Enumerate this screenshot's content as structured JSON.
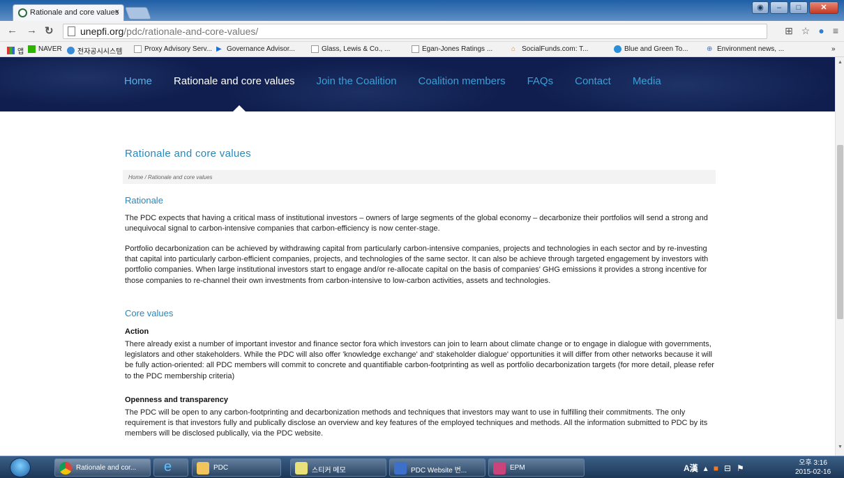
{
  "browser": {
    "tab_title": "Rationale and core values",
    "tab_close": "×",
    "url_host": "unepfi.org",
    "url_path": "/pdc/rationale-and-core-values/",
    "bookmarks": [
      "앱",
      "NAVER",
      "전자공시시스템",
      "Proxy Advisory Serv...",
      "Governance Advisor...",
      "Glass, Lewis & Co., ...",
      "Egan-Jones Ratings ...",
      "SocialFunds.com: T...",
      "Blue and Green To...",
      "Environment news, ..."
    ],
    "bookmarks_more": "»"
  },
  "nav": [
    "Home",
    "Rationale and core values",
    "Join the Coalition",
    "Coalition members",
    "FAQs",
    "Contact",
    "Media"
  ],
  "page": {
    "title": "Rationale and core values",
    "breadcrumb": "Home  /  Rationale and core values",
    "rationale_heading": "Rationale",
    "rationale_p1": "The PDC expects that having a critical mass of institutional investors – owners of large segments of the global economy – decarbonize their portfolios will send a strong and unequivocal signal to carbon-intensive companies that carbon-efficiency is now center-stage.",
    "rationale_p2": "Portfolio decarbonization can be achieved by withdrawing capital from particularly carbon-intensive companies, projects and technologies in each sector and by re-investing that capital into particularly carbon-efficient companies, projects, and technologies of the same sector. It can also be achieve through targeted engagement by investors with portfolio companies. When large institutional investors start to engage and/or re-allocate capital on the basis of companies' GHG emissions it provides a strong incentive for those companies to re-channel their own investments from carbon-intensive to low-carbon activities, assets and technologies.",
    "core_heading": "Core values",
    "action_heading": "Action",
    "action_p": "There already exist a number of important investor and finance sector fora which investors can join to learn about climate change or to engage in dialogue with governments, legislators and other stakeholders. While the PDC will also offer 'knowledge exchange' and' stakeholder dialogue' opportunities it will differ from other networks because it will be fully action-oriented: all PDC members will commit to concrete and quantifiable carbon-footprinting as well as portfolio decarbonization targets (for more detail, please refer to the PDC membership criteria)",
    "openness_heading": "Openness and transparency",
    "openness_p": "The PDC will be open to any carbon-footprinting and decarbonization methods and techniques that investors may want to use in fulfilling their commitments. The only requirement is that investors fully and publically disclose an overview and key features of the employed techniques and methods. All the information submitted to PDC by its members will be disclosed publically, via the PDC website."
  },
  "taskbar": {
    "items": [
      "Rationale and cor...",
      "",
      "PDC",
      "스티커 메모",
      "PDC Website 번...",
      "EPM"
    ],
    "tray": "A漢",
    "time": "오후 3:16",
    "date": "2015-02-16"
  },
  "colors": {
    "hero_bg": "#0f1e4e",
    "link": "#3aa0d8",
    "heading": "#2a86b8"
  }
}
